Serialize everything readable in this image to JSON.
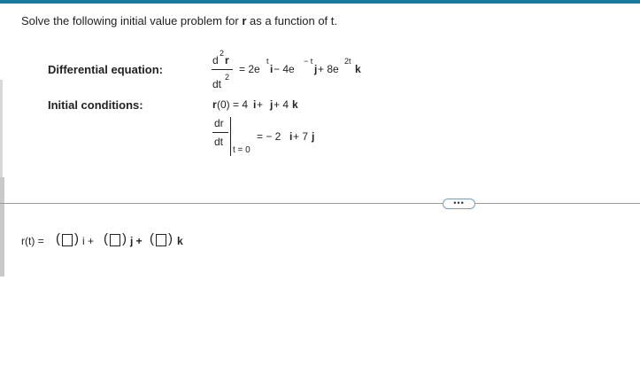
{
  "prompt": {
    "pre": "Solve the following initial value problem for ",
    "bold_var": "r",
    "post": " as a function of t."
  },
  "labels": {
    "diff_eq": "Differential equation:",
    "init_cond": "Initial conditions:"
  },
  "diff_eq": {
    "num": "d",
    "num_exp": "2",
    "num_var": "r",
    "den": "dt",
    "den_exp": "2",
    "rhs_a": "= 2e",
    "rhs_a_exp": "t",
    "rhs_i": "i",
    "rhs_b": " − 4e",
    "rhs_b_exp": "− t",
    "rhs_j": "j",
    "rhs_c": " + 8e",
    "rhs_c_exp": "2t",
    "rhs_k": "k"
  },
  "init": {
    "r0_func": "r",
    "r0_rest": "(0) = 4",
    "r0_i": "i",
    "r0_plus1": " + ",
    "r0_j": "j",
    "r0_plus2": " + 4",
    "r0_k": "k",
    "dr_num": "dr",
    "dr_den": "dt",
    "dr_eval": "t = 0",
    "dr_rhs": "= − 2",
    "dr_i": "i",
    "dr_plus": " + 7",
    "dr_j": "j"
  },
  "more_button_label": "•••",
  "answer": {
    "prefix": "r(t) = ",
    "open": "(",
    "close": ")",
    "i_label": "i +",
    "j_label": "j +",
    "k_label": "k",
    "values": [
      "",
      "",
      ""
    ]
  }
}
